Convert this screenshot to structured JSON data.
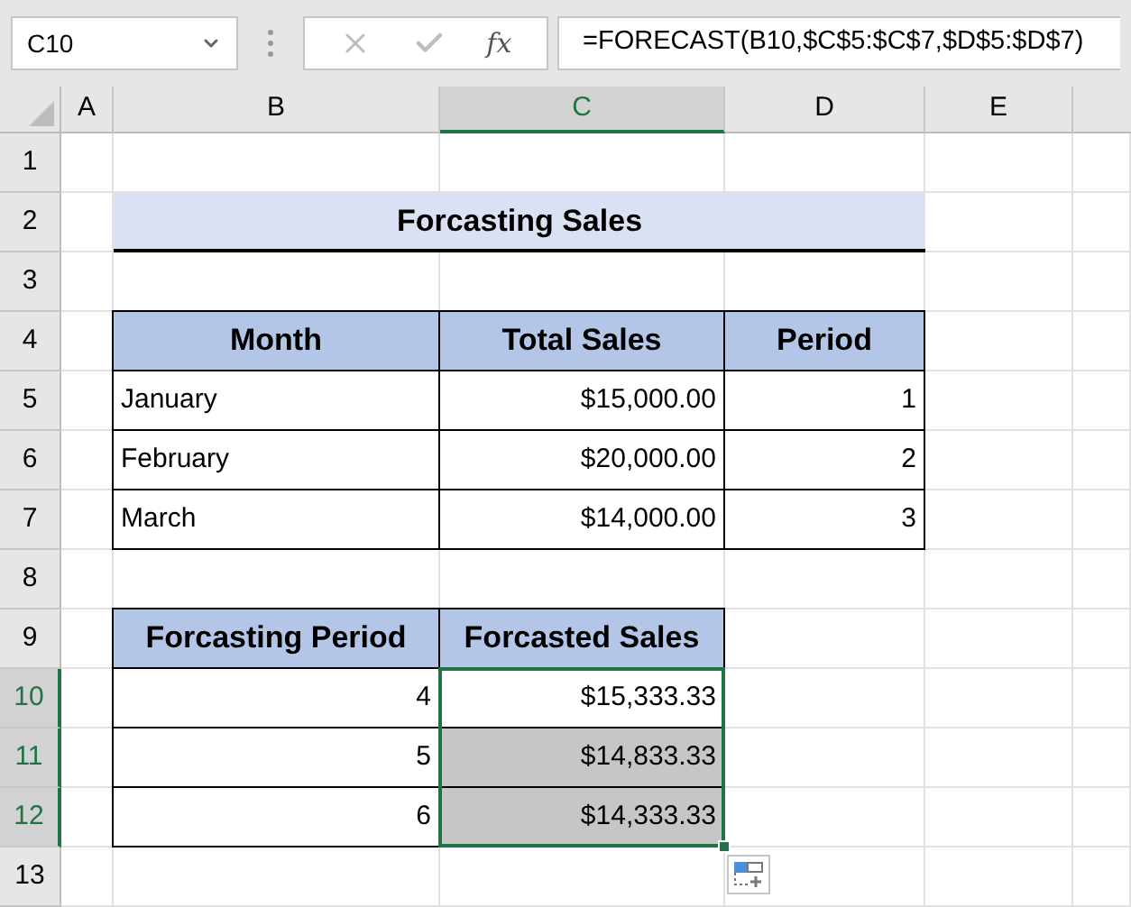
{
  "name_box": "C10",
  "fx_label": "fx",
  "formula": "=FORECAST(B10,$C$5:$C$7,$D$5:$D$7)",
  "columns": [
    {
      "label": "A",
      "selected": false
    },
    {
      "label": "B",
      "selected": false
    },
    {
      "label": "C",
      "selected": true
    },
    {
      "label": "D",
      "selected": false
    },
    {
      "label": "E",
      "selected": false
    }
  ],
  "rows": [
    {
      "label": "1",
      "selected": false
    },
    {
      "label": "2",
      "selected": false
    },
    {
      "label": "3",
      "selected": false
    },
    {
      "label": "4",
      "selected": false
    },
    {
      "label": "5",
      "selected": false
    },
    {
      "label": "6",
      "selected": false
    },
    {
      "label": "7",
      "selected": false
    },
    {
      "label": "8",
      "selected": false
    },
    {
      "label": "9",
      "selected": false
    },
    {
      "label": "10",
      "selected": true
    },
    {
      "label": "11",
      "selected": true
    },
    {
      "label": "12",
      "selected": true
    },
    {
      "label": "13",
      "selected": false
    }
  ],
  "title": "Forcasting Sales",
  "sales_table": {
    "columns": [
      "Month",
      "Total Sales",
      "Period"
    ],
    "rows": [
      [
        "January",
        "$15,000.00",
        "1"
      ],
      [
        "February",
        "$20,000.00",
        "2"
      ],
      [
        "March",
        "$14,000.00",
        "3"
      ]
    ]
  },
  "forecast_table": {
    "columns": [
      "Forcasting Period",
      "Forcasted Sales"
    ],
    "rows": [
      {
        "period": "4",
        "sales": "$15,333.33",
        "selected": true,
        "active": true
      },
      {
        "period": "5",
        "sales": "$14,833.33",
        "selected": true,
        "active": false
      },
      {
        "period": "6",
        "sales": "$14,333.33",
        "selected": true,
        "active": false
      }
    ]
  }
}
